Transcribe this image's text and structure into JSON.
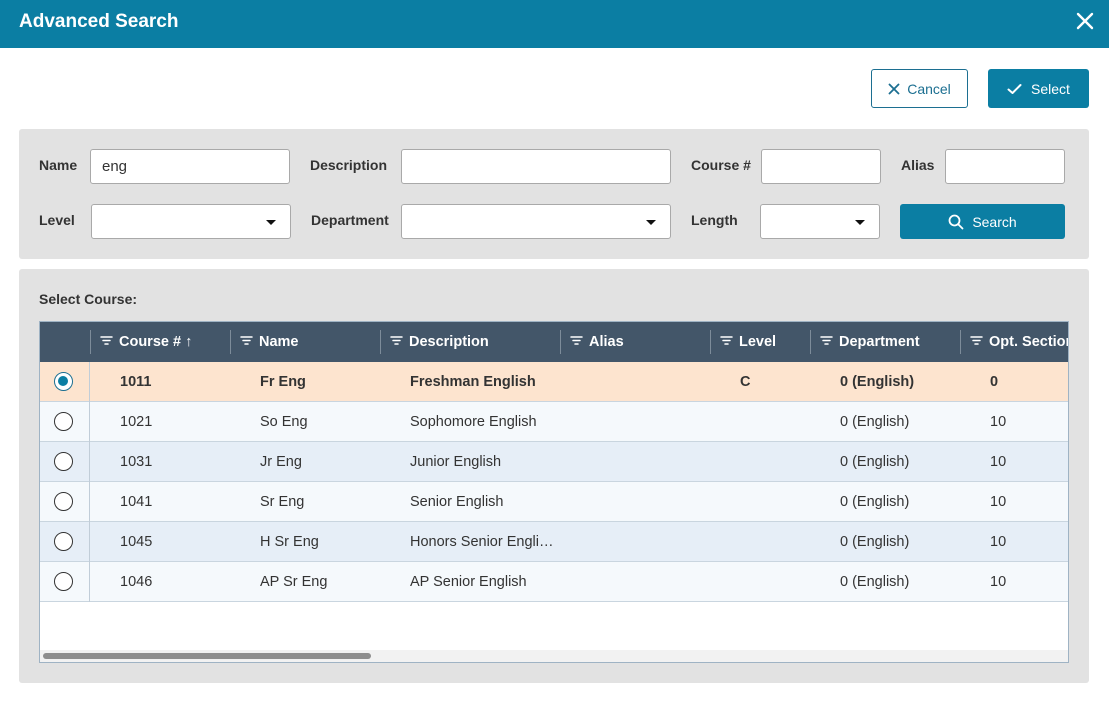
{
  "dialog": {
    "title": "Advanced Search"
  },
  "actions": {
    "cancel_label": "Cancel",
    "select_label": "Select"
  },
  "filters": {
    "name": {
      "label": "Name",
      "value": "eng"
    },
    "description": {
      "label": "Description",
      "value": ""
    },
    "course_num": {
      "label": "Course #",
      "value": ""
    },
    "alias": {
      "label": "Alias",
      "value": ""
    },
    "level": {
      "label": "Level",
      "value": ""
    },
    "department": {
      "label": "Department",
      "value": ""
    },
    "length": {
      "label": "Length",
      "value": ""
    },
    "search_label": "Search"
  },
  "grid": {
    "caption": "Select Course:",
    "columns": [
      "Course # ↑",
      "Name",
      "Description",
      "Alias",
      "Level",
      "Department",
      "Opt. Section"
    ],
    "rows": [
      {
        "course": "1011",
        "name": "Fr Eng",
        "description": "Freshman English",
        "alias": "",
        "level": "C",
        "department": "0 (English)",
        "opt": "0",
        "selected": true
      },
      {
        "course": "1021",
        "name": "So Eng",
        "description": "Sophomore English",
        "alias": "",
        "level": "",
        "department": "0 (English)",
        "opt": "10",
        "selected": false
      },
      {
        "course": "1031",
        "name": "Jr Eng",
        "description": "Junior English",
        "alias": "",
        "level": "",
        "department": "0 (English)",
        "opt": "10",
        "selected": false
      },
      {
        "course": "1041",
        "name": "Sr Eng",
        "description": "Senior English",
        "alias": "",
        "level": "",
        "department": "0 (English)",
        "opt": "10",
        "selected": false
      },
      {
        "course": "1045",
        "name": "H Sr Eng",
        "description": "Honors Senior Engli…",
        "alias": "",
        "level": "",
        "department": "0 (English)",
        "opt": "10",
        "selected": false
      },
      {
        "course": "1046",
        "name": "AP Sr Eng",
        "description": "AP Senior English",
        "alias": "",
        "level": "",
        "department": "0 (English)",
        "opt": "10",
        "selected": false
      }
    ]
  },
  "colors": {
    "header_bg": "#0b7ea3",
    "grid_header_bg": "#435669",
    "selected_row_bg": "#fde4cf",
    "row_bg_a": "#f5f9fc",
    "row_bg_b": "#e6eef7"
  },
  "icons": {
    "close": "close-icon",
    "cancel": "x-icon",
    "select": "checkmark-icon",
    "search": "search-icon",
    "filter": "filter-icon",
    "dropdown": "chevron-down-icon"
  }
}
